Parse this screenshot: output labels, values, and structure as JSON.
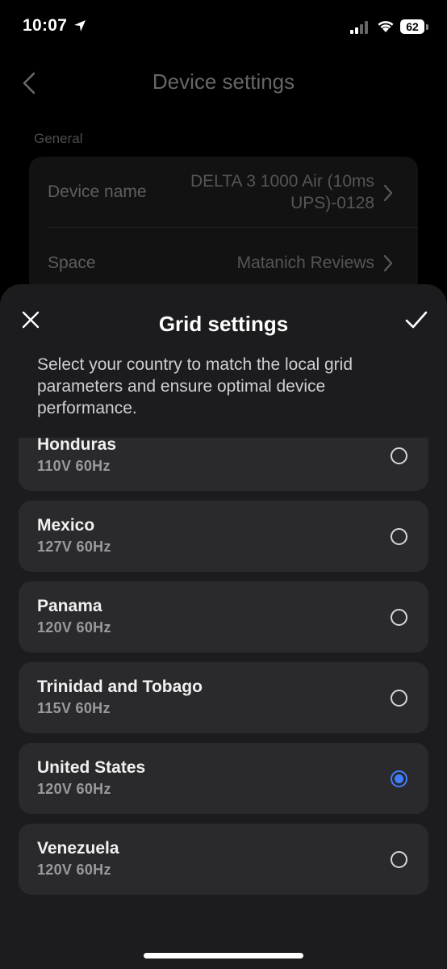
{
  "status_bar": {
    "time": "10:07",
    "battery": "62"
  },
  "background_page": {
    "title": "Device settings",
    "section": "General",
    "rows": [
      {
        "label": "Device name",
        "value": "DELTA 3 1000 Air (10ms UPS)-0128"
      },
      {
        "label": "Space",
        "value": "Matanich Reviews"
      }
    ]
  },
  "sheet": {
    "title": "Grid settings",
    "description": "Select your country to match the local grid parameters and ensure optimal device performance.",
    "countries": [
      {
        "name": "Honduras",
        "spec": "110V 60Hz",
        "selected": false
      },
      {
        "name": "Mexico",
        "spec": "127V 60Hz",
        "selected": false
      },
      {
        "name": "Panama",
        "spec": "120V 60Hz",
        "selected": false
      },
      {
        "name": "Trinidad and Tobago",
        "spec": "115V 60Hz",
        "selected": false
      },
      {
        "name": "United States",
        "spec": "120V 60Hz",
        "selected": true
      },
      {
        "name": "Venezuela",
        "spec": "120V 60Hz",
        "selected": false
      }
    ]
  },
  "colors": {
    "accent": "#3f7dff",
    "sheet_bg": "#1c1c1e",
    "card_bg": "#2a2a2c"
  }
}
